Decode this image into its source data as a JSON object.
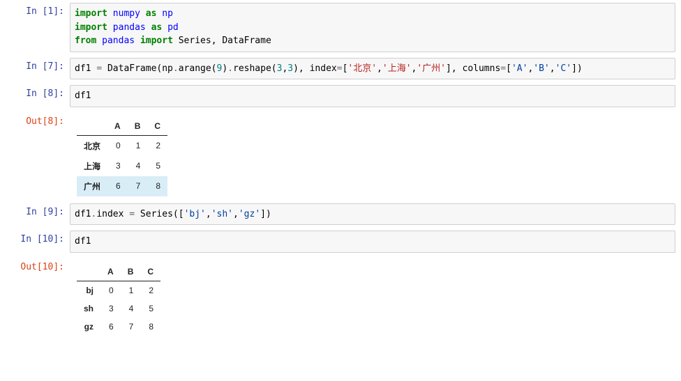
{
  "cells": {
    "c1": {
      "prompt": "In  [1]:",
      "code": {
        "line1_import": "import",
        "line1_numpy": "numpy",
        "line1_as": "as",
        "line1_np": "np",
        "line2_import": "import",
        "line2_pandas": "pandas",
        "line2_as": "as",
        "line2_pd": "pd",
        "line3_from": "from",
        "line3_pandas": "pandas",
        "line3_import": "import",
        "line3_series": "Series, DataFrame"
      }
    },
    "c7": {
      "prompt": "In  [7]:",
      "pre": "df1 ",
      "eq": "=",
      "post": " DataFrame(np",
      "dot1": ".",
      "arange": "arange(",
      "nine": "9",
      "r1": ")",
      "dot2": ".",
      "reshape": "reshape(",
      "n3a": "3",
      "comma1": ",",
      "n3b": "3",
      "r2": "), index",
      "eq2": "=",
      "lb1": "[",
      "s_bj": "'北京'",
      "c_a": ",",
      "s_sh": "'上海'",
      "c_b": ",",
      "s_gz": "'广州'",
      "rb1": "], columns",
      "eq3": "=",
      "lb2": "[",
      "s_A": "'A'",
      "c_c": ",",
      "s_B": "'B'",
      "c_d": ",",
      "s_C": "'C'",
      "rb2": "])"
    },
    "c8": {
      "prompt_in": "In  [8]:",
      "code": "df1",
      "prompt_out": "Out[8]:",
      "table": {
        "cols": [
          "A",
          "B",
          "C"
        ],
        "rows": [
          {
            "idx": "北京",
            "v": [
              "0",
              "1",
              "2"
            ]
          },
          {
            "idx": "上海",
            "v": [
              "3",
              "4",
              "5"
            ]
          },
          {
            "idx": "广州",
            "v": [
              "6",
              "7",
              "8"
            ]
          }
        ]
      }
    },
    "c9": {
      "prompt": "In  [9]:",
      "pre": "df1",
      "dot": ".",
      "idx": "index ",
      "eq": "=",
      "ser": " Series([",
      "s1": "'bj'",
      "c1": ",",
      "s2": "'sh'",
      "c2": ",",
      "s3": "'gz'",
      "end": "])"
    },
    "c10": {
      "prompt_in": "In [10]:",
      "code": "df1",
      "prompt_out": "Out[10]:",
      "table": {
        "cols": [
          "A",
          "B",
          "C"
        ],
        "rows": [
          {
            "idx": "bj",
            "v": [
              "0",
              "1",
              "2"
            ]
          },
          {
            "idx": "sh",
            "v": [
              "3",
              "4",
              "5"
            ]
          },
          {
            "idx": "gz",
            "v": [
              "6",
              "7",
              "8"
            ]
          }
        ]
      }
    }
  }
}
